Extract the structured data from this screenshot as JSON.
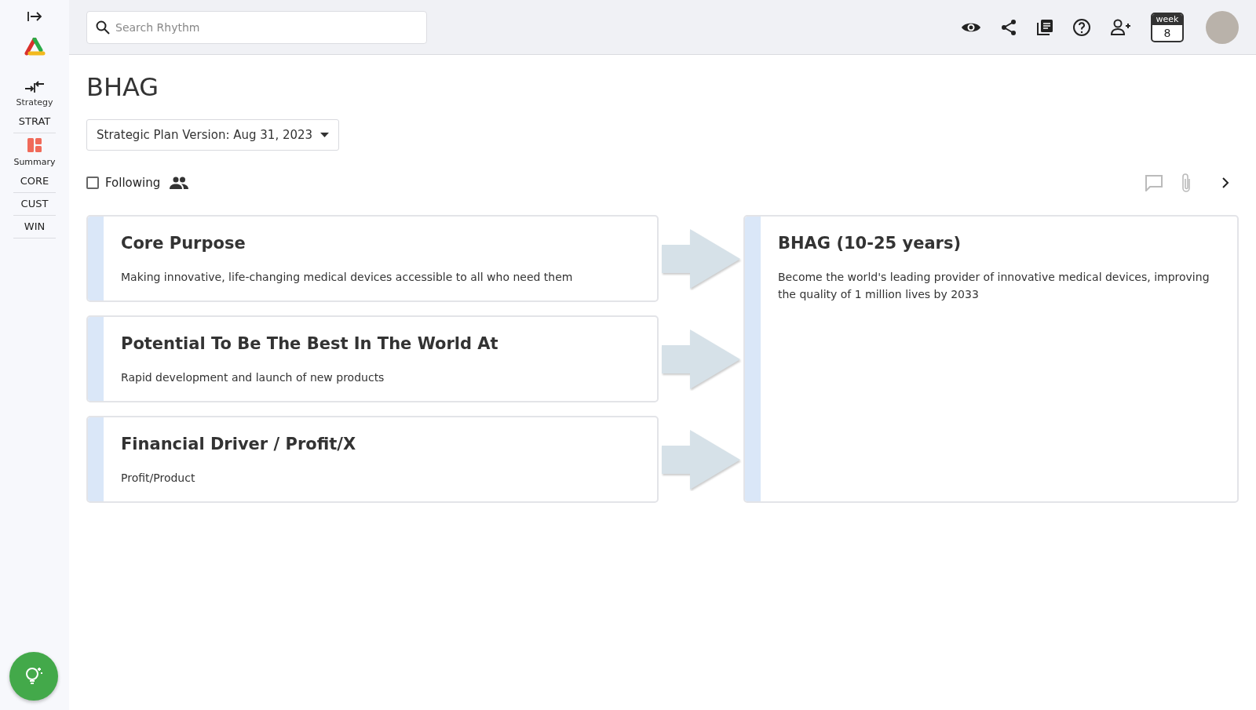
{
  "sidebar": {
    "items": [
      {
        "kind": "section",
        "label": "Strategy",
        "selected": false
      },
      {
        "kind": "link",
        "label": "STRAT"
      },
      {
        "kind": "section",
        "label": "Summary",
        "selected": true
      },
      {
        "kind": "link",
        "label": "CORE"
      },
      {
        "kind": "link",
        "label": "CUST"
      },
      {
        "kind": "link",
        "label": "WIN"
      }
    ]
  },
  "topbar": {
    "search": {
      "placeholder": "Search Rhythm"
    },
    "week": {
      "label": "week",
      "number": "8"
    }
  },
  "page": {
    "title": "BHAG",
    "version": "Strategic Plan Version: Aug 31, 2023",
    "following": {
      "label": "Following",
      "checked": false
    }
  },
  "inputs": [
    {
      "title": "Core Purpose",
      "text": "Making innovative, life-changing medical devices accessible to all who need them"
    },
    {
      "title": "Potential To Be The Best In The World At",
      "text": "Rapid development and launch of new products"
    },
    {
      "title": "Financial Driver / Profit/X",
      "text": "Profit/Product"
    }
  ],
  "result": {
    "title": "BHAG (10-25 years)",
    "text": "Become the world's leading provider of innovative medical devices, improving the quality of 1 million lives by 2033"
  }
}
